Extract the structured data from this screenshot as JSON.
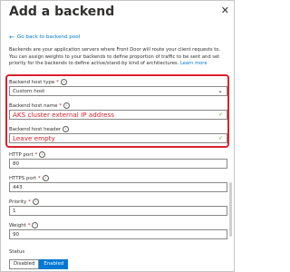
{
  "header": {
    "title": "Add a backend",
    "close_glyph": "✕"
  },
  "back_link": {
    "arrow": "←",
    "label": "Go back to backend pool"
  },
  "description": {
    "text": "Backends are your application servers where Front Door will route your client requests to. You can assign weights to your backends to define proportion of traffic to be sent and set priority for the backends to define active/stand-by kind of architectures.",
    "learn_more": "Learn more"
  },
  "fields": {
    "host_type": {
      "label": "Backend host type",
      "value": "Custom host"
    },
    "host_name": {
      "label": "Backend host name",
      "value": "AKS cluster external IP address"
    },
    "host_header": {
      "label": "Backend host header",
      "value": "Leave empty"
    },
    "http_port": {
      "label": "HTTP port",
      "value": "80"
    },
    "https_port": {
      "label": "HTTPS port",
      "value": "443"
    },
    "priority": {
      "label": "Priority",
      "value": "1"
    },
    "weight": {
      "label": "Weight",
      "value": "90"
    }
  },
  "status": {
    "label": "Status",
    "options": [
      "Disabled",
      "Enabled"
    ],
    "selected": "Enabled"
  },
  "colors": {
    "accent": "#0078d4",
    "highlight": "#d9232e",
    "valid": "#57a300"
  }
}
